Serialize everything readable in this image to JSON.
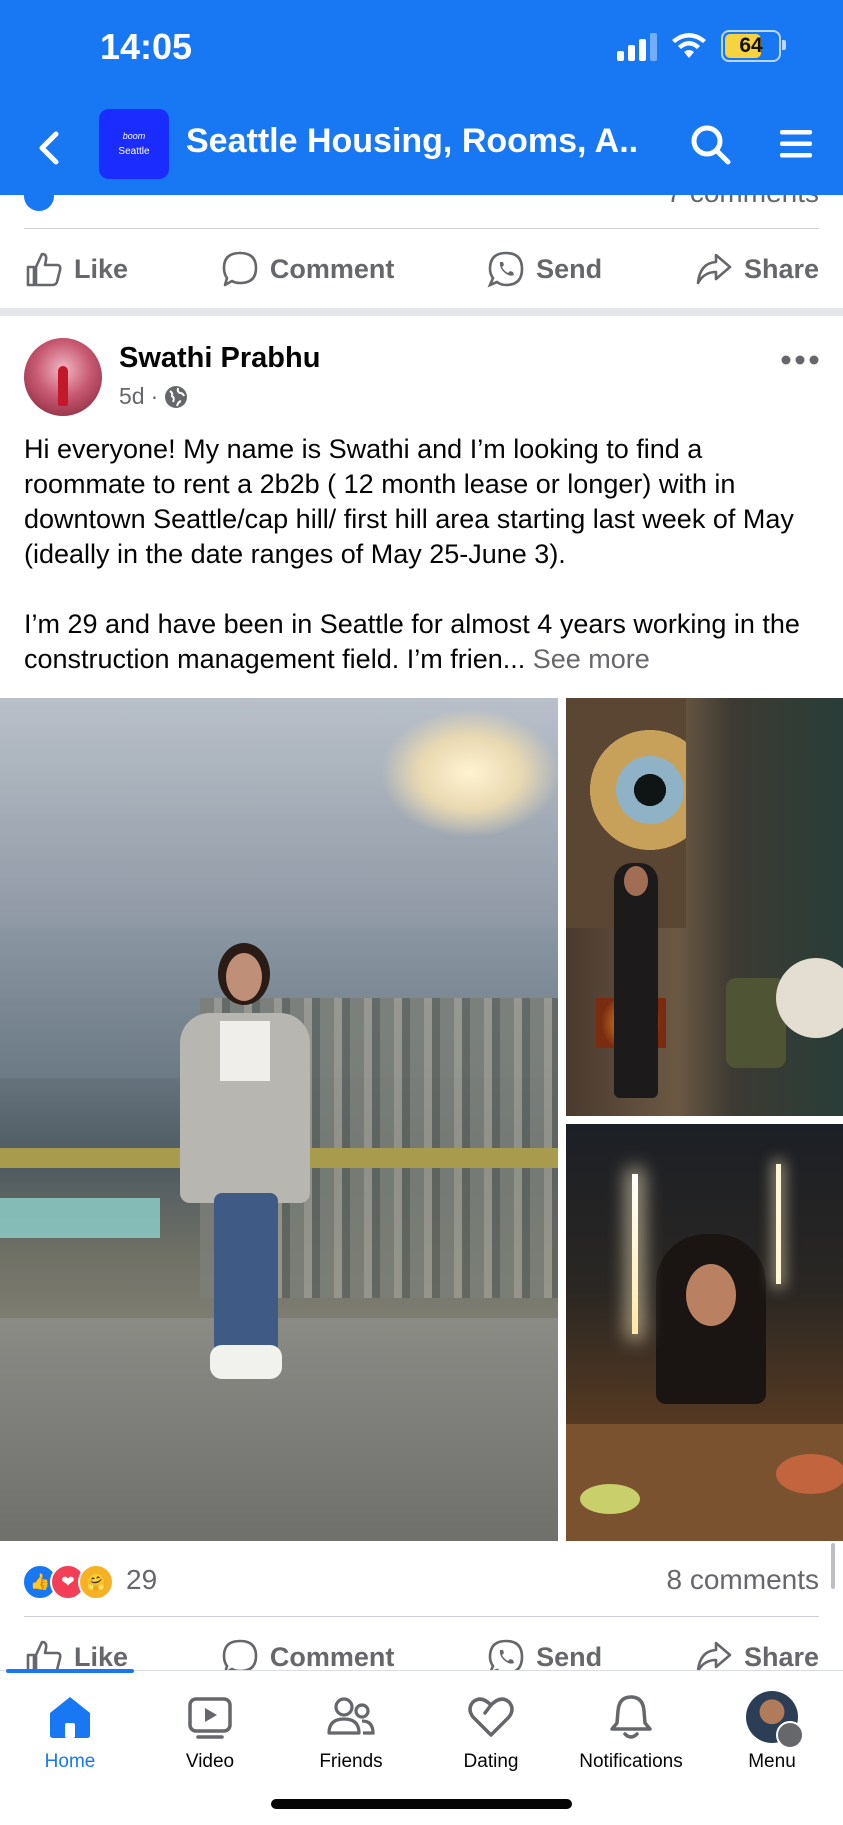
{
  "status_bar": {
    "time": "14:05",
    "battery": "64"
  },
  "nav": {
    "title": "Seattle Housing, Rooms, A...",
    "logo_line1": "boom",
    "logo_line2": "Seattle"
  },
  "previous_post": {
    "comments_partial": "7 comments"
  },
  "actions": {
    "like": "Like",
    "comment": "Comment",
    "send": "Send",
    "share": "Share"
  },
  "post": {
    "author": "Swathi Prabhu",
    "time": "5d",
    "separator": "·",
    "paragraph1": "Hi everyone! My name is Swathi and I’m looking to find a roommate to rent a 2b2b ( 12 month lease or longer) with in downtown Seattle/cap hill/ first hill area starting last week of May (ideally in the date ranges of May 25-June 3).",
    "paragraph2": "I’m 29 and have been in Seattle for almost 4 years working in the construction management field. I’m frien...",
    "see_more": "See more",
    "reaction_count": "29",
    "comments": "8 comments",
    "reactions": [
      "like",
      "love",
      "care"
    ]
  },
  "tabs": [
    {
      "label": "Home",
      "icon": "home-icon",
      "active": true
    },
    {
      "label": "Video",
      "icon": "video-icon",
      "active": false
    },
    {
      "label": "Friends",
      "icon": "friends-icon",
      "active": false
    },
    {
      "label": "Dating",
      "icon": "dating-icon",
      "active": false
    },
    {
      "label": "Notifications",
      "icon": "bell-icon",
      "active": false
    },
    {
      "label": "Menu",
      "icon": "profile-avatar",
      "active": false
    }
  ],
  "colors": {
    "brand": "#1877f2",
    "text": "#050505",
    "secondary": "#65676b"
  }
}
